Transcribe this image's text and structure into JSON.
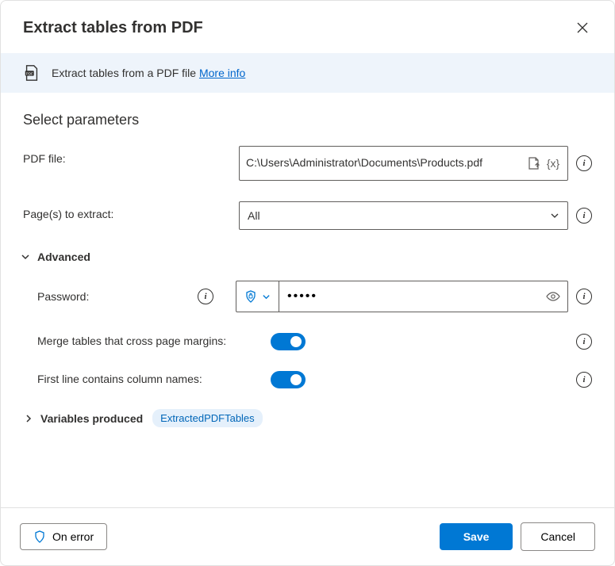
{
  "header": {
    "title": "Extract tables from PDF"
  },
  "info_bar": {
    "text": "Extract tables from a PDF file",
    "link": "More info"
  },
  "section": {
    "title": "Select parameters"
  },
  "pdf_file": {
    "label": "PDF file:",
    "value": "C:\\Users\\Administrator\\Documents\\Products.pdf"
  },
  "pages": {
    "label": "Page(s) to extract:",
    "value": "All"
  },
  "advanced": {
    "label": "Advanced"
  },
  "password": {
    "label": "Password:",
    "value": "•••••"
  },
  "merge": {
    "label": "Merge tables that cross page margins:"
  },
  "first_line": {
    "label": "First line contains column names:"
  },
  "variables": {
    "label": "Variables produced",
    "badge": "ExtractedPDFTables"
  },
  "footer": {
    "on_error": "On error",
    "save": "Save",
    "cancel": "Cancel"
  }
}
